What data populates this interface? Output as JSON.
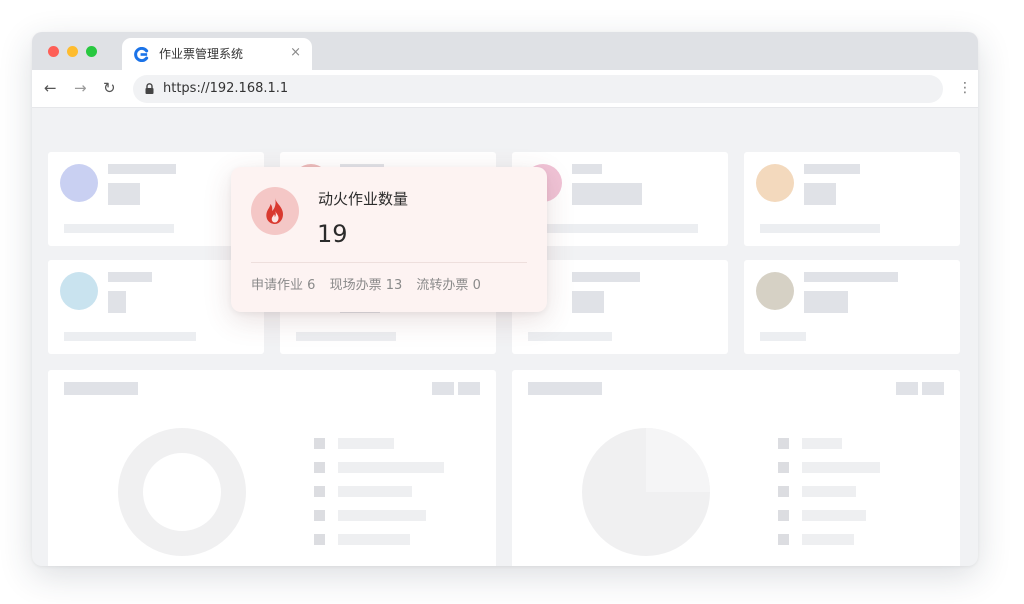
{
  "browser": {
    "tab_title": "作业票管理系统",
    "tab_close": "×",
    "url": "https://192.168.1.1",
    "nav": {
      "back": "←",
      "forward": "→",
      "reload": "↻"
    },
    "menu": "⋮"
  },
  "popup": {
    "icon": "fire-icon",
    "title": "动火作业数量",
    "value": "19",
    "stats": [
      {
        "label": "申请作业",
        "value": "6"
      },
      {
        "label": "现场办票",
        "value": "13"
      },
      {
        "label": "流转办票",
        "value": "0"
      }
    ]
  },
  "cards": [
    {
      "circle_color": "#c9d0f2"
    },
    {
      "circle_color": "#ecbcbc"
    },
    {
      "circle_color": "#f0c3d6"
    },
    {
      "circle_color": "#f3d9bd"
    },
    {
      "circle_color": "#c9e3ef"
    },
    {
      "circle_color": "#dcd7bf"
    },
    {
      "circle_color": "#ead9b4"
    },
    {
      "circle_color": "#d6d1c5"
    }
  ],
  "colors": {
    "popup_background": "#fdf3f2",
    "fire_icon_fill": "#d9392f",
    "fire_icon_bg": "#f4c7c6"
  }
}
